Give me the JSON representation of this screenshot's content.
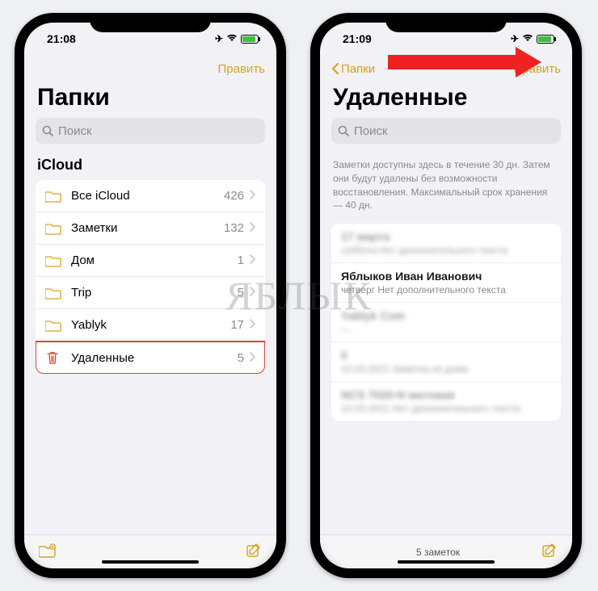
{
  "watermark": "ЯБЛЫК",
  "left": {
    "time": "21:08",
    "edit": "Править",
    "title": "Папки",
    "search_placeholder": "Поиск",
    "section": "iCloud",
    "folders": [
      {
        "name": "Все iCloud",
        "count": "426",
        "icon": "folder"
      },
      {
        "name": "Заметки",
        "count": "132",
        "icon": "folder"
      },
      {
        "name": "Дом",
        "count": "1",
        "icon": "folder"
      },
      {
        "name": "Trip",
        "count": "5",
        "icon": "folder"
      },
      {
        "name": "Yablyk",
        "count": "17",
        "icon": "folder"
      },
      {
        "name": "Удаленные",
        "count": "5",
        "icon": "trash",
        "highlight": true
      }
    ]
  },
  "right": {
    "time": "21:09",
    "back": "Папки",
    "edit": "Править",
    "title": "Удаленные",
    "search_placeholder": "Поиск",
    "info": "Заметки доступны здесь в течение 30 дн. Затем они будут удалены без возможности восстановления. Максимальный срок хранения — 40 дн.",
    "notes": [
      {
        "title": "17 марта",
        "sub": "суббота  Нет дополнительного текста",
        "blur": true
      },
      {
        "title": "Яблыков Иван Иванович",
        "sub": "четверг  Нет дополнительного текста",
        "blur": false
      },
      {
        "title": "Yablyk Com",
        "sub": "—",
        "blur": true
      },
      {
        "title": "0",
        "sub": "10.03.2021  Заметка из дома",
        "blur": true
      },
      {
        "title": "NCS 7020-N матовая",
        "sub": "10.03.2021  Нет дополнительного текста",
        "blur": true
      }
    ],
    "footer": "5 заметок"
  }
}
